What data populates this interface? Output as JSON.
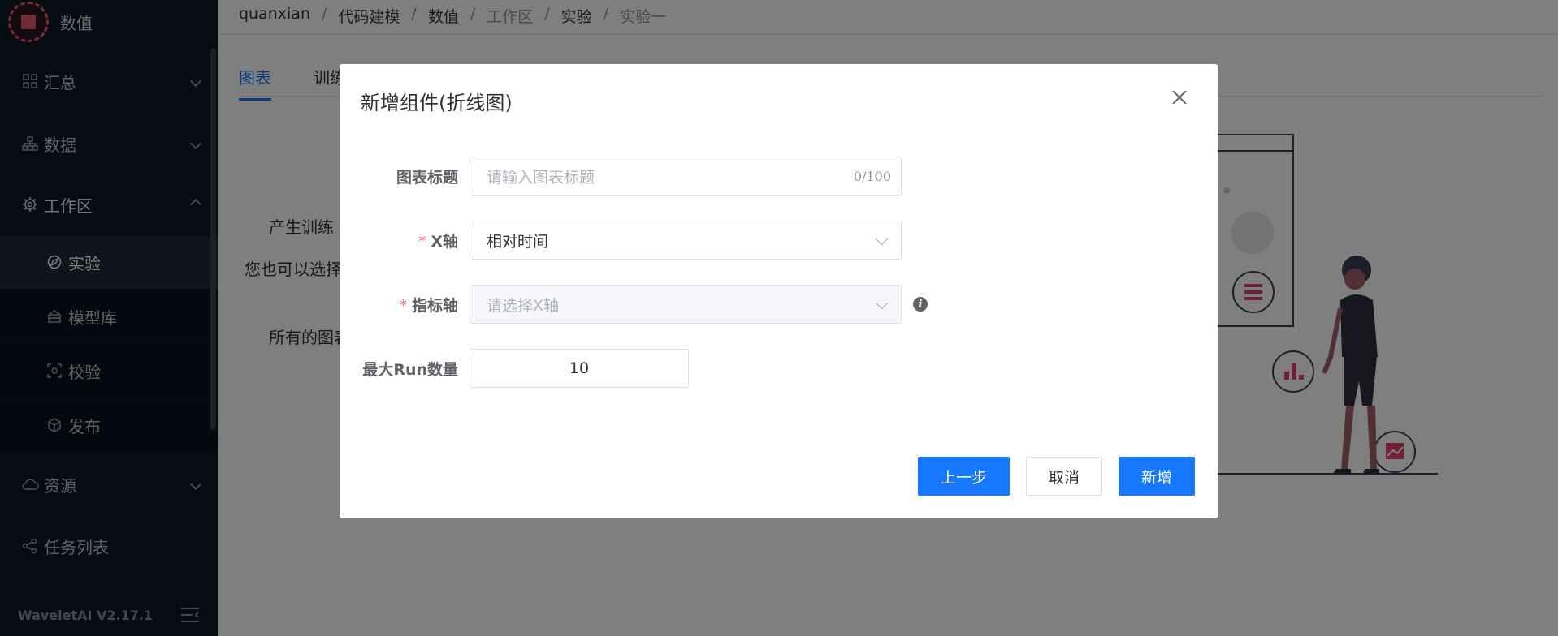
{
  "app": {
    "name": "数值",
    "version": "WaveletAI V2.17.1"
  },
  "sidebar": {
    "items": [
      {
        "label": "汇总",
        "icon": "grid-icon"
      },
      {
        "label": "数据",
        "icon": "hierarchy-icon"
      },
      {
        "label": "工作区",
        "icon": "chip-icon"
      },
      {
        "label": "实验",
        "icon": "compass-icon"
      },
      {
        "label": "模型库",
        "icon": "database-icon"
      },
      {
        "label": "校验",
        "icon": "scan-icon"
      },
      {
        "label": "发布",
        "icon": "cube-icon"
      },
      {
        "label": "资源",
        "icon": "cloud-icon"
      },
      {
        "label": "任务列表",
        "icon": "share-icon"
      }
    ]
  },
  "breadcrumb": [
    "quanxian",
    "代码建模",
    "数值",
    "工作区",
    "实验",
    "实验一"
  ],
  "tabs": [
    "图表",
    "训练"
  ],
  "background_text": {
    "line1": "产生训练",
    "line2": "您也可以选择",
    "line3": "所有的图表"
  },
  "modal": {
    "title": "新增组件(折线图)",
    "fields": {
      "chart_title": {
        "label": "图表标题",
        "placeholder": "请输入图表标题",
        "counter": "0/100"
      },
      "x_axis": {
        "label": "X轴",
        "value": "相对时间"
      },
      "metric_axis": {
        "label": "指标轴",
        "placeholder": "请选择X轴"
      },
      "max_runs": {
        "label": "最大Run数量",
        "value": "10"
      }
    },
    "buttons": {
      "prev": "上一步",
      "cancel": "取消",
      "add": "新增"
    }
  },
  "colors": {
    "primary": "#1677ff",
    "sidebar_bg": "#0f1629",
    "accent": "#e05a6d",
    "required": "#f56c6c"
  }
}
